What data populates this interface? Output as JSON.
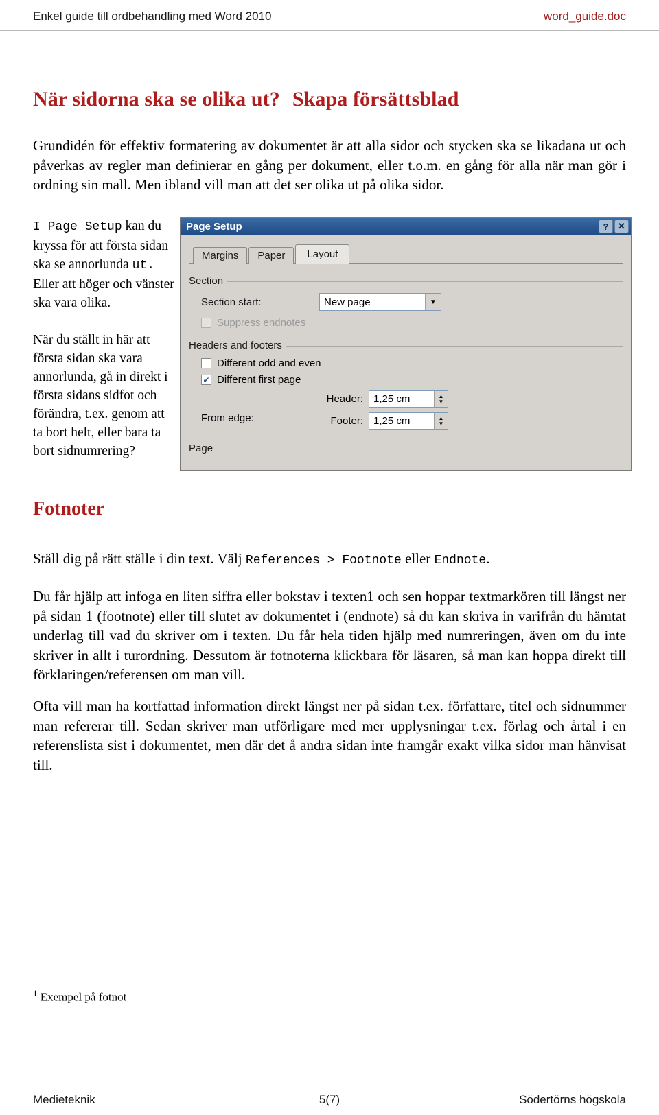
{
  "header": {
    "left": "Enkel guide till ordbehandling med Word 2010",
    "right": "word_guide.doc"
  },
  "title": {
    "part1": "När sidorna ska se olika ut?",
    "part2": "Skapa försättsblad"
  },
  "intro": "Grundidén för effektiv formatering av dokumentet är att alla sidor och stycken ska se likadana ut och påverkas av regler man definierar en gång per dokument, eller t.o.m. en gång för alla när man gör i ordning sin mall. Men ibland vill man att det ser olika ut på olika sidor.",
  "left_column": {
    "block1_code": "I Page Setup",
    "block1_rest": " kan du kryssa för att första sidan ska se annorlunda ",
    "block1_code2": "ut.",
    "block1_tail": " Eller att höger och vänster ska vara olika.",
    "block2": "När du ställt in här att första sidan ska vara annorlunda, gå in direkt i första sidans sidfot och förändra, t.ex. genom att ta bort helt, eller bara ta bort sidnumrering?"
  },
  "dialog": {
    "title": "Page Setup",
    "help_button": "?",
    "close_button": "✕",
    "tabs": [
      {
        "label": "Margins",
        "active": false
      },
      {
        "label": "Paper",
        "active": false
      },
      {
        "label": "Layout",
        "active": true
      }
    ],
    "section_group": {
      "label": "Section",
      "start_label": "Section start:",
      "start_value": "New page",
      "suppress_endnotes": "Suppress endnotes",
      "suppress_checked": false
    },
    "headers_group": {
      "label": "Headers and footers",
      "odd_even_label": "Different odd and even",
      "odd_even_checked": false,
      "first_page_label": "Different first page",
      "first_page_checked": true,
      "from_edge_label": "From edge:",
      "header_label": "Header:",
      "header_value": "1,25 cm",
      "footer_label": "Footer:",
      "footer_value": "1,25 cm"
    },
    "page_group": {
      "label": "Page"
    }
  },
  "fotnoter": {
    "heading": "Fotnoter",
    "p1_a": "Ställ dig på rätt ställe i din text. Välj ",
    "p1_code1": "References > Footnote",
    "p1_b": " eller ",
    "p1_code2": "Endnote",
    "p1_c": ".",
    "p2": "Du får hjälp att infoga en liten siffra eller bokstav i texten1 och sen hoppar textmarkören till längst ner på sidan 1 (footnote) eller till slutet av dokumentet i (endnote) så du kan skriva in varifrån du hämtat underlag till vad du skriver om i texten. Du får hela tiden hjälp med numreringen, även om du inte skriver in allt i turordning. Dessutom är fotnoterna klickbara för läsaren, så man kan hoppa direkt till förklaringen/referensen om man vill.",
    "p3": "Ofta vill man ha kortfattad information direkt längst ner på sidan t.ex. författare, titel och sidnummer man refererar till. Sedan skriver man utförligare med mer upplysningar t.ex. förlag och årtal i en referenslista sist i dokumentet, men där det å andra sidan inte framgår exakt vilka sidor man hänvisat till."
  },
  "footnote": {
    "marker": "1",
    "text": "Exempel på fotnot"
  },
  "footer": {
    "left": "Medieteknik",
    "center": "5(7)",
    "right": "Södertörns högskola"
  },
  "colors": {
    "accent_red": "#b01c1c",
    "header_red": "#a02020",
    "dialog_titlebar": "#2c5a94",
    "dialog_face": "#d6d3ce"
  }
}
